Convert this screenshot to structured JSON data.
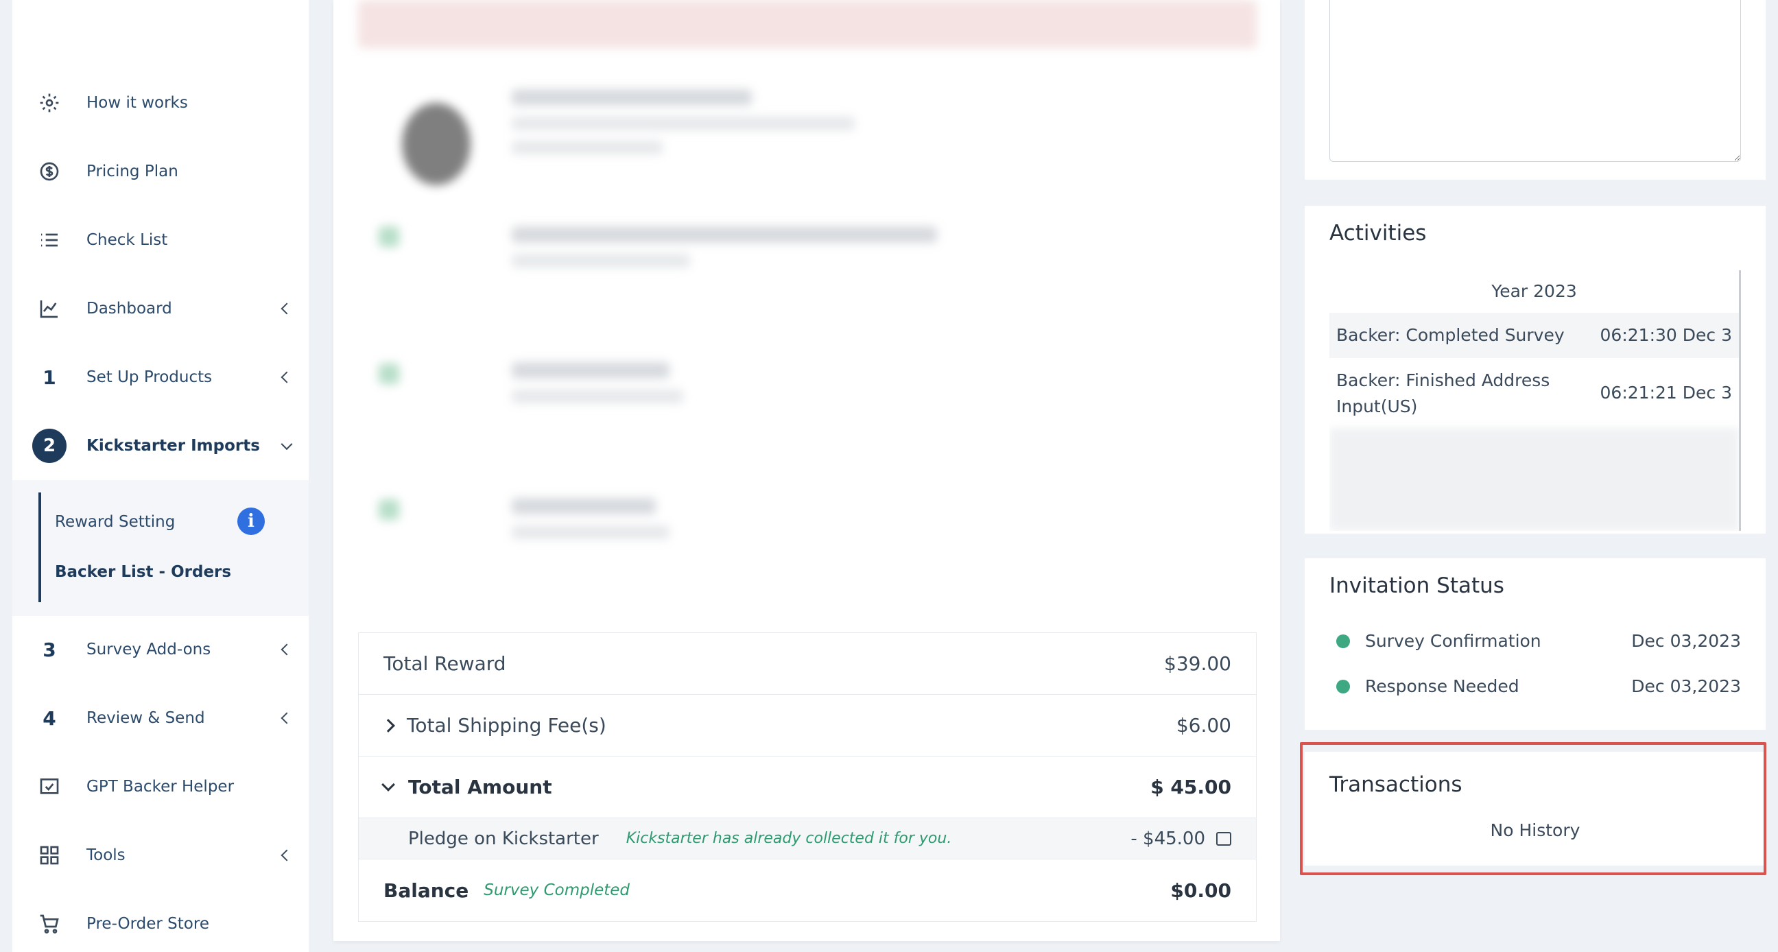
{
  "sidebar": {
    "items": [
      {
        "icon": "gear-icon",
        "label": "How it works"
      },
      {
        "icon": "dollar-circle-icon",
        "label": "Pricing Plan"
      },
      {
        "icon": "list-icon",
        "label": "Check List"
      },
      {
        "icon": "chart-line-icon",
        "label": "Dashboard"
      },
      {
        "num": "1",
        "label": "Set Up Products"
      },
      {
        "num": "2",
        "label": "Kickstarter Imports"
      },
      {
        "num": "3",
        "label": "Survey Add-ons"
      },
      {
        "num": "4",
        "label": "Review & Send"
      },
      {
        "icon": "check-square-icon",
        "label": "GPT Backer Helper"
      },
      {
        "icon": "grid-icon",
        "label": "Tools"
      },
      {
        "icon": "cart-icon",
        "label": "Pre-Order Store"
      }
    ],
    "sub_items": [
      "Reward Setting",
      "Backer List - Orders"
    ],
    "info_glyph": "i"
  },
  "summary": {
    "total_reward_label": "Total Reward",
    "total_reward_value": "$39.00",
    "shipping_label": "Total Shipping Fee(s)",
    "shipping_value": "$6.00",
    "total_amount_label": "Total Amount",
    "total_amount_value": "$ 45.00",
    "pledge_label": "Pledge on Kickstarter",
    "pledge_note": "Kickstarter has already collected it for you.",
    "pledge_value": "- $45.00",
    "balance_label": "Balance",
    "balance_status": "Survey Completed",
    "balance_value": "$0.00"
  },
  "activities": {
    "title": "Activities",
    "year": "Year 2023",
    "rows": [
      {
        "text": "Backer: Completed Survey",
        "time": "06:21:30 Dec 3"
      },
      {
        "text": "Backer: Finished Address Input(US)",
        "time": "06:21:21 Dec 3"
      }
    ]
  },
  "invitation": {
    "title": "Invitation Status",
    "rows": [
      {
        "label": "Survey Confirmation",
        "date": "Dec 03,2023"
      },
      {
        "label": "Response Needed",
        "date": "Dec 03,2023"
      }
    ]
  },
  "transactions": {
    "title": "Transactions",
    "empty_text": "No History"
  },
  "colors": {
    "primary": "#1f3b5c",
    "success": "#3ea882",
    "highlight": "#d9534f",
    "info": "#2f6fe0"
  }
}
